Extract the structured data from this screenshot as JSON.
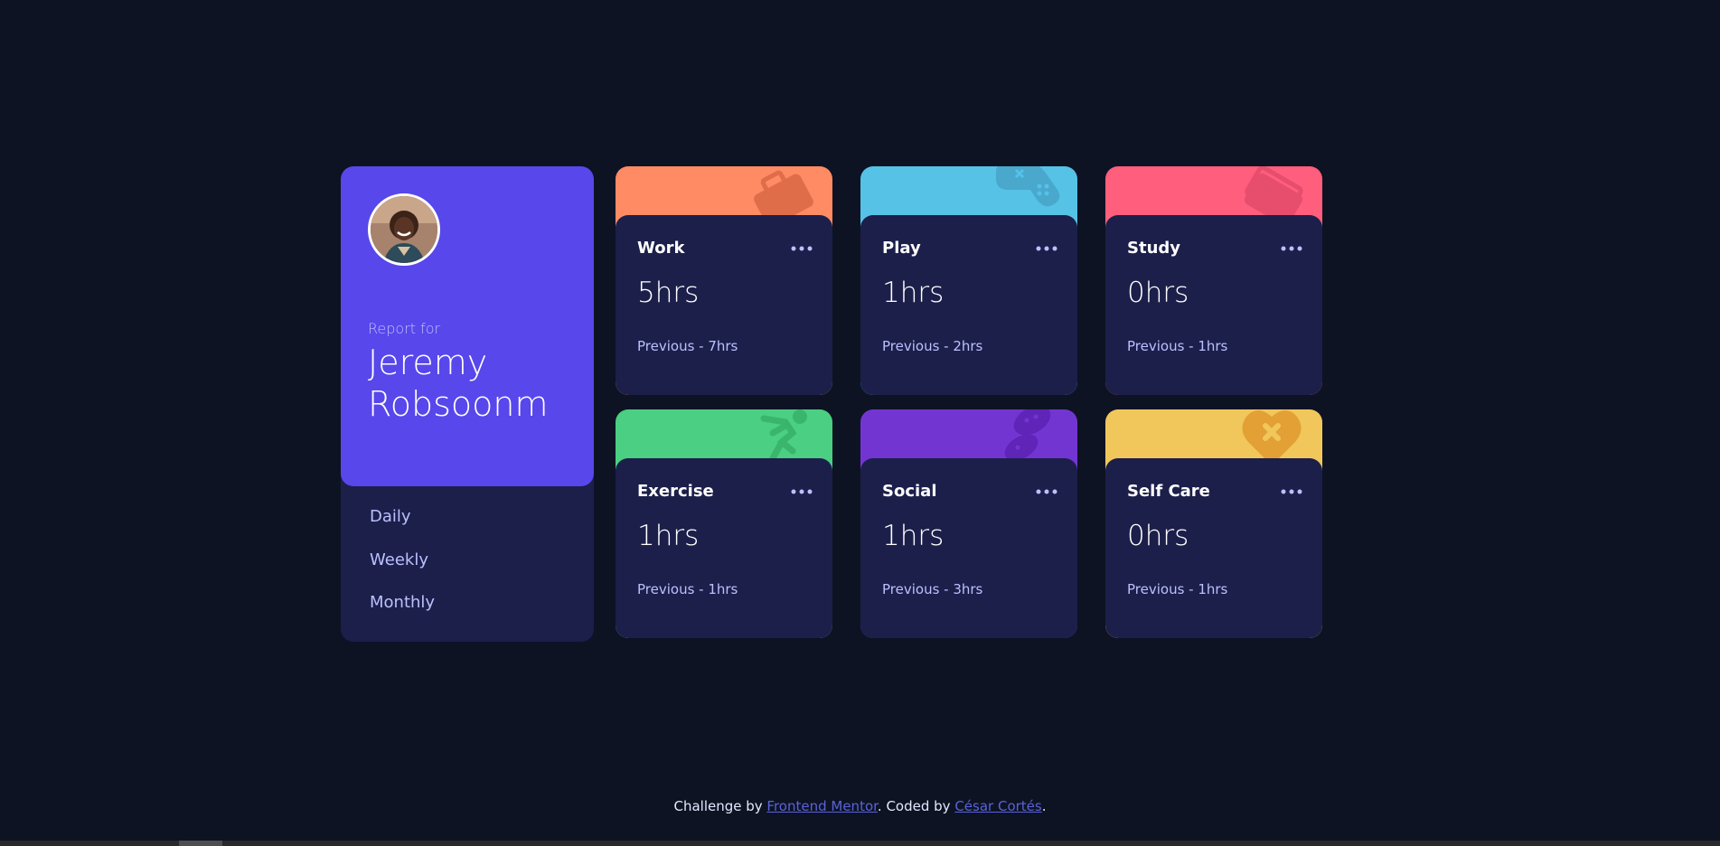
{
  "colors": {
    "page_bg": "#0d1323",
    "card_bg": "#1c1f4a",
    "profile_bg": "#5847eb",
    "muted_text": "#bbc0ff",
    "link": "#5a62d8",
    "work": "#ff8b64",
    "play": "#55c2e6",
    "study": "#ff5e7d",
    "exercise": "#4bcf82",
    "social": "#7335d2",
    "self_care": "#f1c75b"
  },
  "profile": {
    "report_for": "Report for",
    "name": "Jeremy Robsoonm",
    "avatar_icon": "user-avatar-photo"
  },
  "timeframes": [
    "Daily",
    "Weekly",
    "Monthly"
  ],
  "cards": [
    {
      "title": "Work",
      "hours": "5hrs",
      "previous": "Previous - 7hrs",
      "color": "#ff8b64",
      "icon": "briefcase-icon"
    },
    {
      "title": "Play",
      "hours": "1hrs",
      "previous": "Previous - 2hrs",
      "color": "#55c2e6",
      "icon": "gamepad-icon"
    },
    {
      "title": "Study",
      "hours": "0hrs",
      "previous": "Previous - 1hrs",
      "color": "#ff5e7d",
      "icon": "books-icon"
    },
    {
      "title": "Exercise",
      "hours": "1hrs",
      "previous": "Previous - 1hrs",
      "color": "#4bcf82",
      "icon": "running-icon"
    },
    {
      "title": "Social",
      "hours": "1hrs",
      "previous": "Previous - 3hrs",
      "color": "#7335d2",
      "icon": "chat-bubbles-icon"
    },
    {
      "title": "Self Care",
      "hours": "0hrs",
      "previous": "Previous - 1hrs",
      "color": "#f1c75b",
      "icon": "heart-bandage-icon"
    }
  ],
  "footer": {
    "prefix": "Challenge by ",
    "link1": "Frontend Mentor",
    "middle": ". Coded by ",
    "link2": "César Cortés",
    "suffix": "."
  }
}
